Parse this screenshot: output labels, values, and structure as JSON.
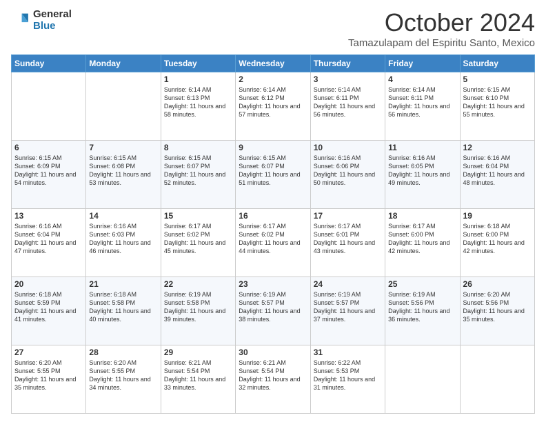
{
  "header": {
    "logo_general": "General",
    "logo_blue": "Blue",
    "month_title": "October 2024",
    "subtitle": "Tamazulapam del Espiritu Santo, Mexico"
  },
  "days_of_week": [
    "Sunday",
    "Monday",
    "Tuesday",
    "Wednesday",
    "Thursday",
    "Friday",
    "Saturday"
  ],
  "weeks": [
    [
      {
        "day": "",
        "info": ""
      },
      {
        "day": "",
        "info": ""
      },
      {
        "day": "1",
        "info": "Sunrise: 6:14 AM\nSunset: 6:13 PM\nDaylight: 11 hours and 58 minutes."
      },
      {
        "day": "2",
        "info": "Sunrise: 6:14 AM\nSunset: 6:12 PM\nDaylight: 11 hours and 57 minutes."
      },
      {
        "day": "3",
        "info": "Sunrise: 6:14 AM\nSunset: 6:11 PM\nDaylight: 11 hours and 56 minutes."
      },
      {
        "day": "4",
        "info": "Sunrise: 6:14 AM\nSunset: 6:11 PM\nDaylight: 11 hours and 56 minutes."
      },
      {
        "day": "5",
        "info": "Sunrise: 6:15 AM\nSunset: 6:10 PM\nDaylight: 11 hours and 55 minutes."
      }
    ],
    [
      {
        "day": "6",
        "info": "Sunrise: 6:15 AM\nSunset: 6:09 PM\nDaylight: 11 hours and 54 minutes."
      },
      {
        "day": "7",
        "info": "Sunrise: 6:15 AM\nSunset: 6:08 PM\nDaylight: 11 hours and 53 minutes."
      },
      {
        "day": "8",
        "info": "Sunrise: 6:15 AM\nSunset: 6:07 PM\nDaylight: 11 hours and 52 minutes."
      },
      {
        "day": "9",
        "info": "Sunrise: 6:15 AM\nSunset: 6:07 PM\nDaylight: 11 hours and 51 minutes."
      },
      {
        "day": "10",
        "info": "Sunrise: 6:16 AM\nSunset: 6:06 PM\nDaylight: 11 hours and 50 minutes."
      },
      {
        "day": "11",
        "info": "Sunrise: 6:16 AM\nSunset: 6:05 PM\nDaylight: 11 hours and 49 minutes."
      },
      {
        "day": "12",
        "info": "Sunrise: 6:16 AM\nSunset: 6:04 PM\nDaylight: 11 hours and 48 minutes."
      }
    ],
    [
      {
        "day": "13",
        "info": "Sunrise: 6:16 AM\nSunset: 6:04 PM\nDaylight: 11 hours and 47 minutes."
      },
      {
        "day": "14",
        "info": "Sunrise: 6:16 AM\nSunset: 6:03 PM\nDaylight: 11 hours and 46 minutes."
      },
      {
        "day": "15",
        "info": "Sunrise: 6:17 AM\nSunset: 6:02 PM\nDaylight: 11 hours and 45 minutes."
      },
      {
        "day": "16",
        "info": "Sunrise: 6:17 AM\nSunset: 6:02 PM\nDaylight: 11 hours and 44 minutes."
      },
      {
        "day": "17",
        "info": "Sunrise: 6:17 AM\nSunset: 6:01 PM\nDaylight: 11 hours and 43 minutes."
      },
      {
        "day": "18",
        "info": "Sunrise: 6:17 AM\nSunset: 6:00 PM\nDaylight: 11 hours and 42 minutes."
      },
      {
        "day": "19",
        "info": "Sunrise: 6:18 AM\nSunset: 6:00 PM\nDaylight: 11 hours and 42 minutes."
      }
    ],
    [
      {
        "day": "20",
        "info": "Sunrise: 6:18 AM\nSunset: 5:59 PM\nDaylight: 11 hours and 41 minutes."
      },
      {
        "day": "21",
        "info": "Sunrise: 6:18 AM\nSunset: 5:58 PM\nDaylight: 11 hours and 40 minutes."
      },
      {
        "day": "22",
        "info": "Sunrise: 6:19 AM\nSunset: 5:58 PM\nDaylight: 11 hours and 39 minutes."
      },
      {
        "day": "23",
        "info": "Sunrise: 6:19 AM\nSunset: 5:57 PM\nDaylight: 11 hours and 38 minutes."
      },
      {
        "day": "24",
        "info": "Sunrise: 6:19 AM\nSunset: 5:57 PM\nDaylight: 11 hours and 37 minutes."
      },
      {
        "day": "25",
        "info": "Sunrise: 6:19 AM\nSunset: 5:56 PM\nDaylight: 11 hours and 36 minutes."
      },
      {
        "day": "26",
        "info": "Sunrise: 6:20 AM\nSunset: 5:56 PM\nDaylight: 11 hours and 35 minutes."
      }
    ],
    [
      {
        "day": "27",
        "info": "Sunrise: 6:20 AM\nSunset: 5:55 PM\nDaylight: 11 hours and 35 minutes."
      },
      {
        "day": "28",
        "info": "Sunrise: 6:20 AM\nSunset: 5:55 PM\nDaylight: 11 hours and 34 minutes."
      },
      {
        "day": "29",
        "info": "Sunrise: 6:21 AM\nSunset: 5:54 PM\nDaylight: 11 hours and 33 minutes."
      },
      {
        "day": "30",
        "info": "Sunrise: 6:21 AM\nSunset: 5:54 PM\nDaylight: 11 hours and 32 minutes."
      },
      {
        "day": "31",
        "info": "Sunrise: 6:22 AM\nSunset: 5:53 PM\nDaylight: 11 hours and 31 minutes."
      },
      {
        "day": "",
        "info": ""
      },
      {
        "day": "",
        "info": ""
      }
    ]
  ]
}
